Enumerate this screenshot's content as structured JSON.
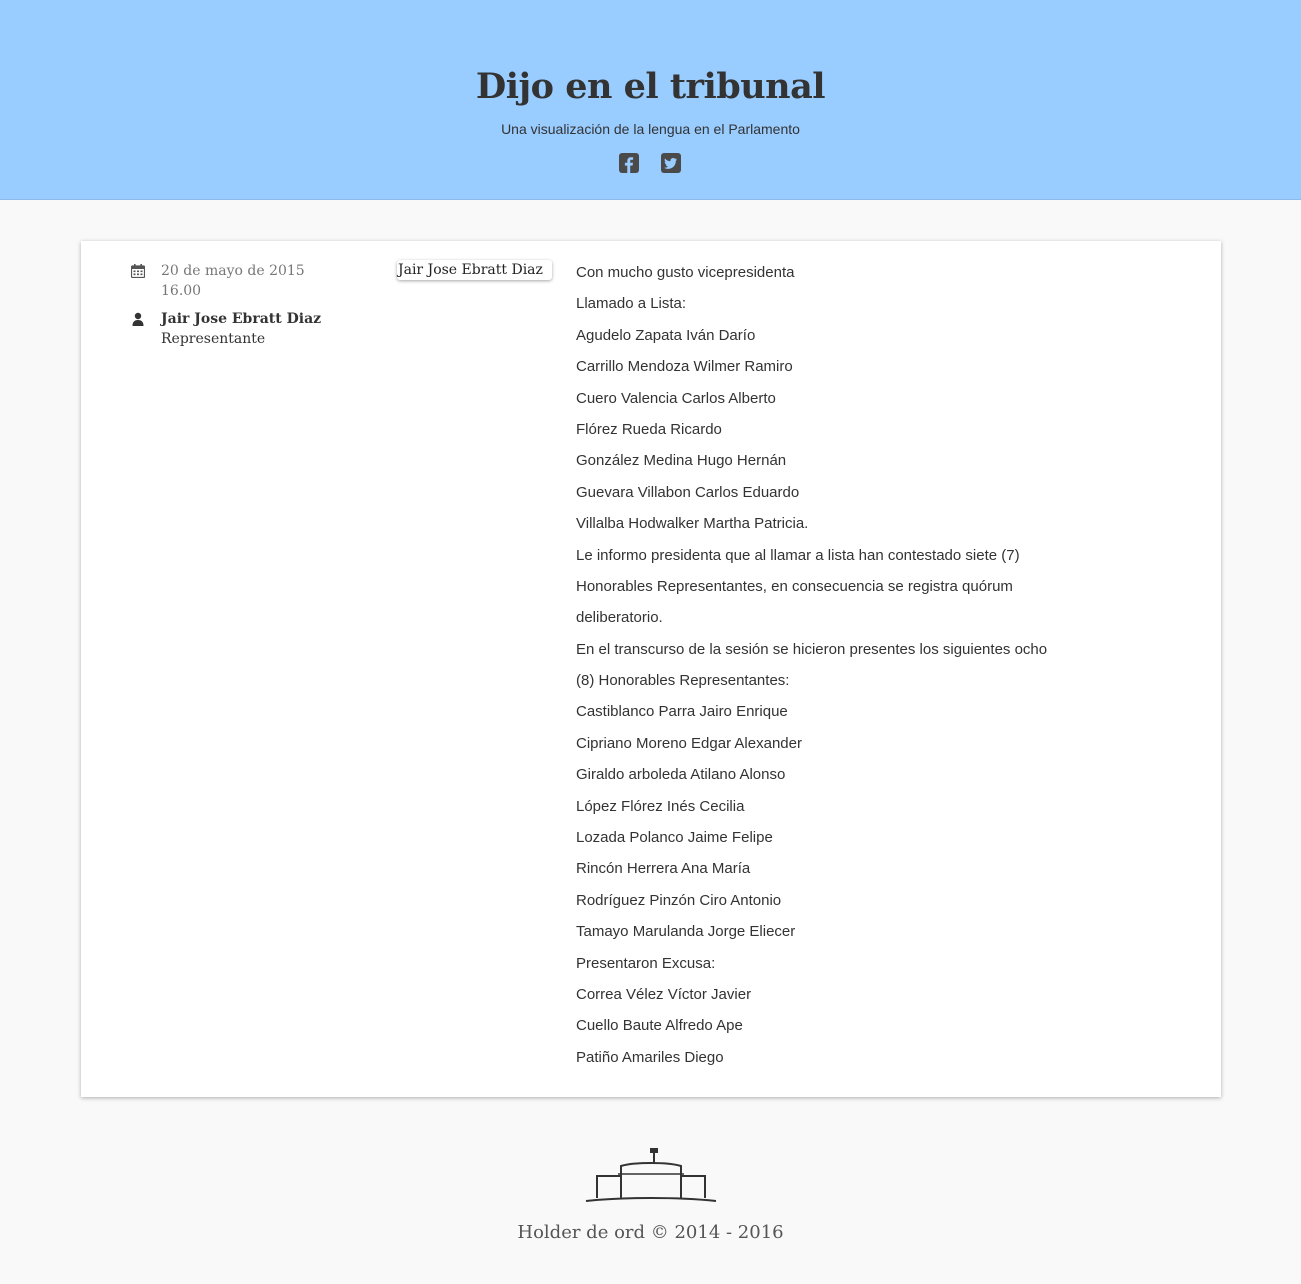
{
  "header": {
    "title": "Dijo en el tribunal",
    "subtitle": "Una visualización de la lengua en el Parlamento",
    "background": "#99ccff",
    "social": [
      {
        "icon": "facebook-square-icon"
      },
      {
        "icon": "twitter-square-icon"
      }
    ]
  },
  "entry": {
    "date": "20 de mayo de 2015",
    "time": "16.00",
    "speaker_name": "Jair Jose Ebratt Diaz",
    "speaker_role": "Representante",
    "tag_label": "Jair Jose Ebratt Diaz",
    "speech_lines": [
      "Con mucho gusto vicepresidenta",
      "Llamado a Lista:",
      "Agudelo Zapata Iván Darío",
      "Carrillo Mendoza Wilmer Ramiro",
      "Cuero Valencia Carlos Alberto",
      "Flórez Rueda Ricardo",
      "González Medina Hugo Hernán",
      "Guevara Villabon Carlos Eduardo",
      "Villalba Hodwalker Martha Patricia.",
      "Le informo presidenta que al llamar a lista han contestado siete (7)",
      "Honorables Representantes, en consecuencia se registra quórum",
      "deliberatorio.",
      "En el transcurso de la sesión se hicieron presentes los siguientes ocho",
      "(8) Honorables Representantes:",
      "Castiblanco Parra Jairo Enrique",
      "Cipriano Moreno Edgar Alexander",
      "Giraldo arboleda Atilano Alonso",
      "López Flórez Inés Cecilia",
      "Lozada Polanco Jaime Felipe",
      "Rincón Herrera Ana María",
      "Rodríguez Pinzón Ciro Antonio",
      "Tamayo Marulanda Jorge Eliecer",
      "Presentaron Excusa:",
      "Correa Vélez Víctor Javier",
      "Cuello Baute Alfredo Ape",
      "Patiño Amariles Diego"
    ]
  },
  "footer": {
    "logo_icon": "parliament-building-icon",
    "text": "Holder de ord © 2014 - 2016"
  }
}
